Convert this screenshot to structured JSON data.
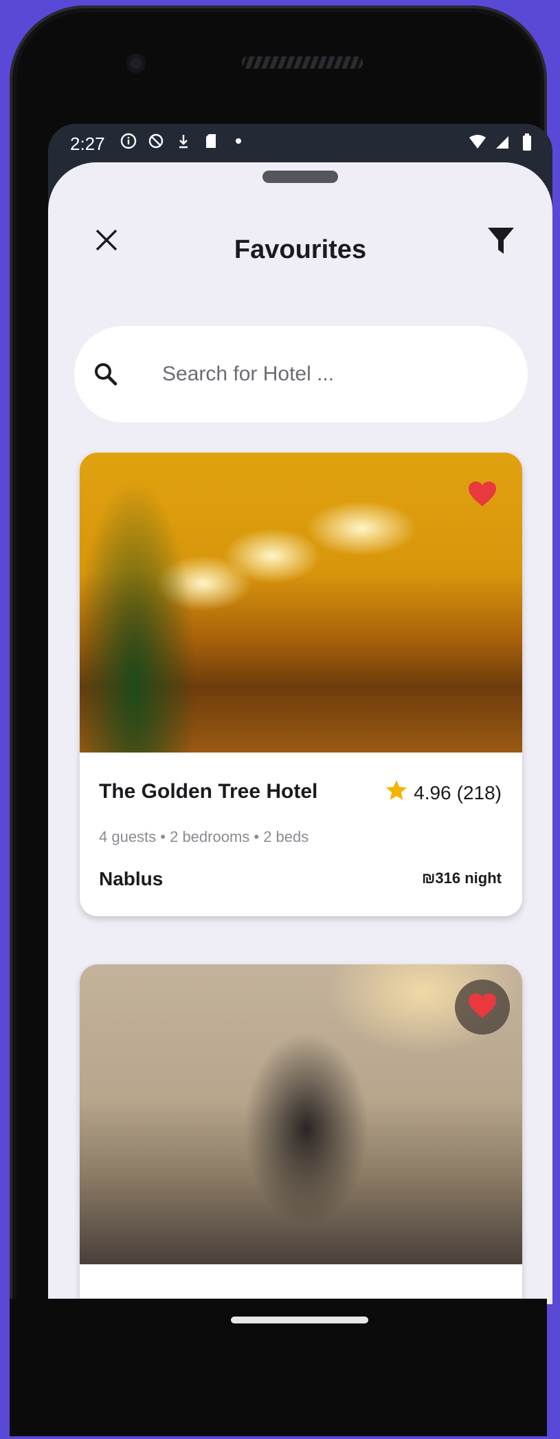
{
  "status_bar": {
    "time": "2:27",
    "left_icons": [
      "info-icon",
      "shield-icon",
      "download-icon",
      "sd-card-icon",
      "dot-icon"
    ],
    "right_icons": [
      "wifi-icon",
      "signal-icon",
      "battery-icon"
    ]
  },
  "header": {
    "title": "Favourites",
    "close_icon": "close-icon",
    "filter_icon": "filter-icon"
  },
  "search": {
    "placeholder": "Search for Hotel ...",
    "value": ""
  },
  "hotels": [
    {
      "name": "The Golden Tree Hotel",
      "rating": "4.96",
      "reviews": "(218)",
      "details": "4 guests • 2 bedrooms • 2 beds",
      "city": "Nablus",
      "price": "₪316 night",
      "favourite": true
    },
    {
      "favourite": true
    }
  ],
  "colors": {
    "heart": "#e8393f",
    "star": "#f5b400",
    "sheet_background": "#efeef6",
    "device_frame": "#0b0b0c",
    "page_background": "#5a48d6"
  }
}
